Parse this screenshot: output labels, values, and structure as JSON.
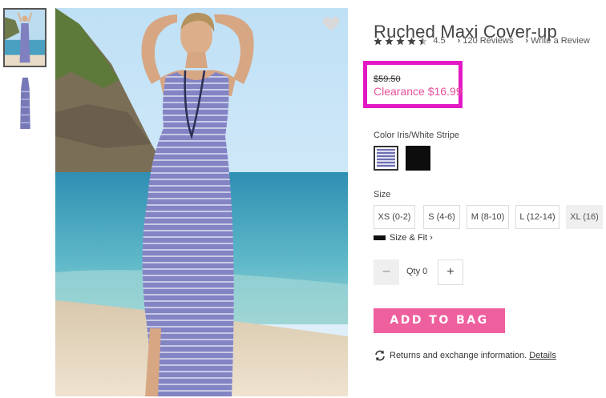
{
  "product": {
    "title": "Ruched Maxi Cover-up",
    "rating": "4.5",
    "reviews_link": "120 Reviews",
    "write_review_link": "Write a Review",
    "was_price": "$59.50",
    "clearance_price": "Clearance $16.99"
  },
  "color": {
    "label": "Color",
    "selected": "Iris/White Stripe",
    "swatches": [
      "iris-white-stripe",
      "black"
    ]
  },
  "size": {
    "label": "Size",
    "options": [
      "XS (0-2)",
      "S (4-6)",
      "M (8-10)",
      "L (12-14)",
      "XL (16)"
    ],
    "size_fit_link": "Size & Fit"
  },
  "quantity": {
    "label": "Qty 0",
    "minus": "–",
    "plus": "+"
  },
  "actions": {
    "add_to_bag": "ADD TO BAG"
  },
  "returns": {
    "text": "Returns and exchange information.",
    "details_link": "Details"
  },
  "icons": {
    "favorite": "heart-icon",
    "return": "exchange-arrows-icon",
    "ruler": "ruler-icon"
  },
  "colors": {
    "accent": "#ee5f9e",
    "clearance": "#e8519a",
    "highlight_box": "#e31ac3"
  }
}
